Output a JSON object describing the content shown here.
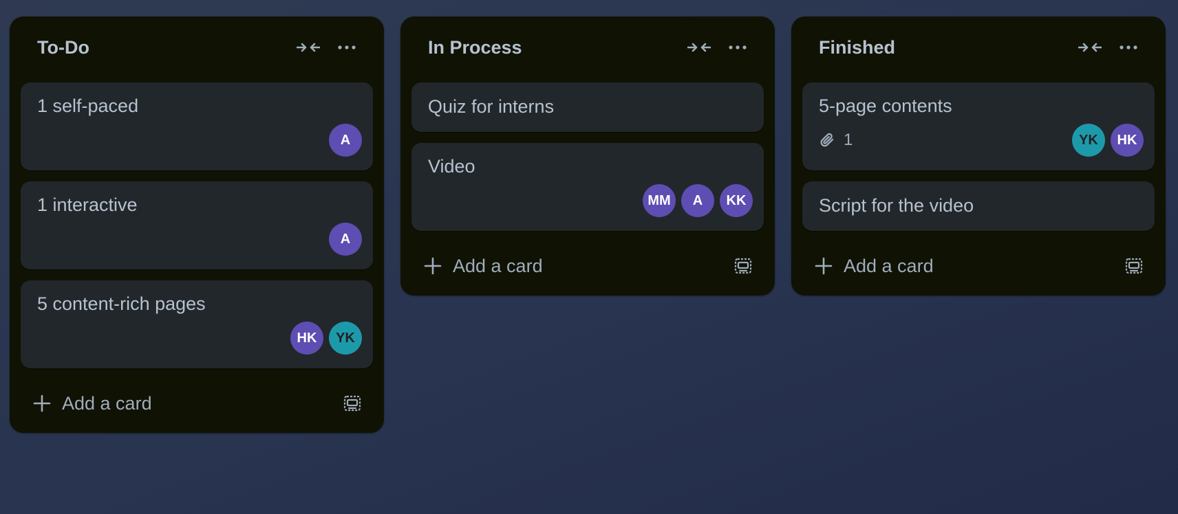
{
  "colors": {
    "list_bg": "#101204",
    "card_bg": "#22272b",
    "text": "#b6c2cf",
    "avatar_purple": "#5e4db2",
    "avatar_teal": "#1d9aaa"
  },
  "lists": [
    {
      "title": "To-Do",
      "add_label": "Add a card",
      "cards": [
        {
          "title": "1 self-paced",
          "members": [
            "A"
          ]
        },
        {
          "title": "1 interactive",
          "members": [
            "A"
          ]
        },
        {
          "title": "5 content-rich pages",
          "members": [
            "HK",
            "YK"
          ]
        }
      ]
    },
    {
      "title": "In Process",
      "add_label": "Add a card",
      "cards": [
        {
          "title": "Quiz for interns",
          "members": []
        },
        {
          "title": "Video",
          "members": [
            "MM",
            "A",
            "KK"
          ]
        }
      ]
    },
    {
      "title": "Finished",
      "add_label": "Add a card",
      "cards": [
        {
          "title": "5-page contents",
          "attachments": "1",
          "members": [
            "YK",
            "HK"
          ]
        },
        {
          "title": "Script for the video",
          "members": []
        }
      ]
    }
  ],
  "icons": [
    "collapse-icon",
    "more-icon",
    "plus-icon",
    "template-icon",
    "paperclip-icon"
  ]
}
